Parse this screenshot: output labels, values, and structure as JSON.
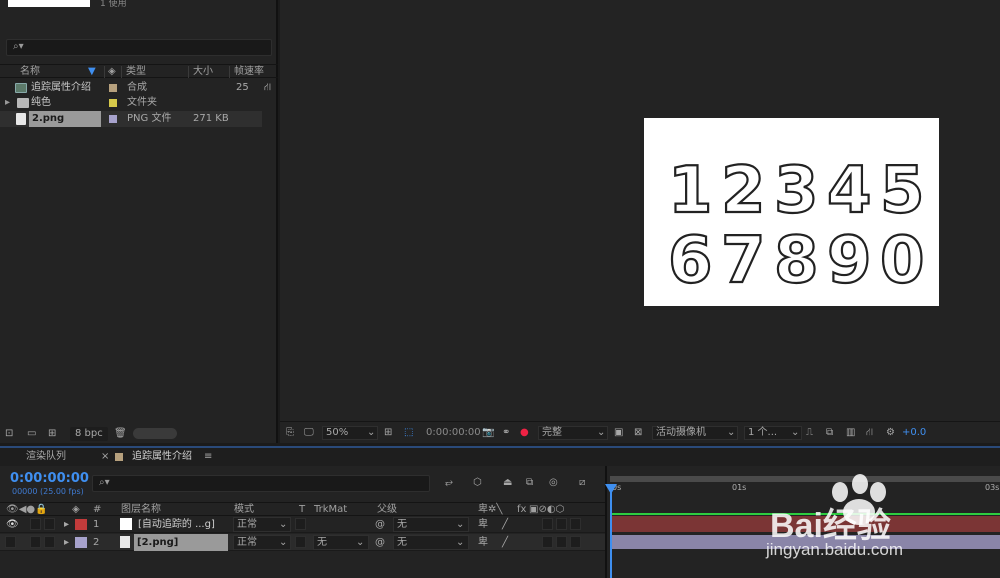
{
  "project": {
    "thumb_label": "1 使用",
    "search_icon": "search-icon",
    "columns": {
      "name": "名称",
      "type": "类型",
      "size": "大小",
      "fps": "帧速率"
    },
    "items": [
      {
        "name": "追踪属性介绍",
        "type": "合成",
        "size": "",
        "fps": "25",
        "icon": "composition-icon",
        "label_color": "#b6a07d"
      },
      {
        "name": "纯色",
        "type": "文件夹",
        "size": "",
        "fps": "",
        "icon": "folder-icon",
        "label_color": "#d6c94a"
      },
      {
        "name": "2.png",
        "type": "PNG 文件",
        "size": "271 KB",
        "fps": "",
        "icon": "png-file-icon",
        "label_color": "#a7a2cc"
      }
    ],
    "footer_bpc": "8 bpc"
  },
  "viewer": {
    "canvas_alt": "1234567890",
    "digits_row1": [
      "1",
      "2",
      "3",
      "4",
      "5"
    ],
    "digits_row2": [
      "6",
      "7",
      "8",
      "9",
      "0"
    ],
    "zoom": "50%",
    "timecode": "0:00:00:00",
    "resolution": "完整",
    "camera": "活动摄像机",
    "views": "1 个...",
    "exposure": "+0.0"
  },
  "timeline": {
    "tab_render": "渲染队列",
    "tab_close": "×",
    "tab_comp": "追踪属性介绍",
    "tab_menu": "≡",
    "timecode": "0:00:00:00",
    "fps_label": "00000 (25.00 fps)",
    "columns": {
      "num": "#",
      "layer_name": "图层名称",
      "mode": "模式",
      "t": "T",
      "trkmat": "TrkMat",
      "parent": "父级",
      "fx": "fx"
    },
    "ruler": [
      "0s",
      "01s",
      "03s"
    ],
    "layers": [
      {
        "num": "1",
        "name": "[自动追踪的 ...g]",
        "mode": "正常",
        "trkmat": "",
        "parent": "无",
        "label_color": "#c23b3b"
      },
      {
        "num": "2",
        "name": "[2.png]",
        "mode": "正常",
        "trkmat": "无",
        "parent": "无",
        "label_color": "#a7a2cc"
      }
    ]
  },
  "watermark": {
    "text": "Bai经验",
    "url": "jingyan.baidu.com"
  },
  "colors": {
    "accent": "#3f8ff0",
    "layer1_bar": "#7b3535",
    "layer2_bar": "#8a85a8"
  }
}
